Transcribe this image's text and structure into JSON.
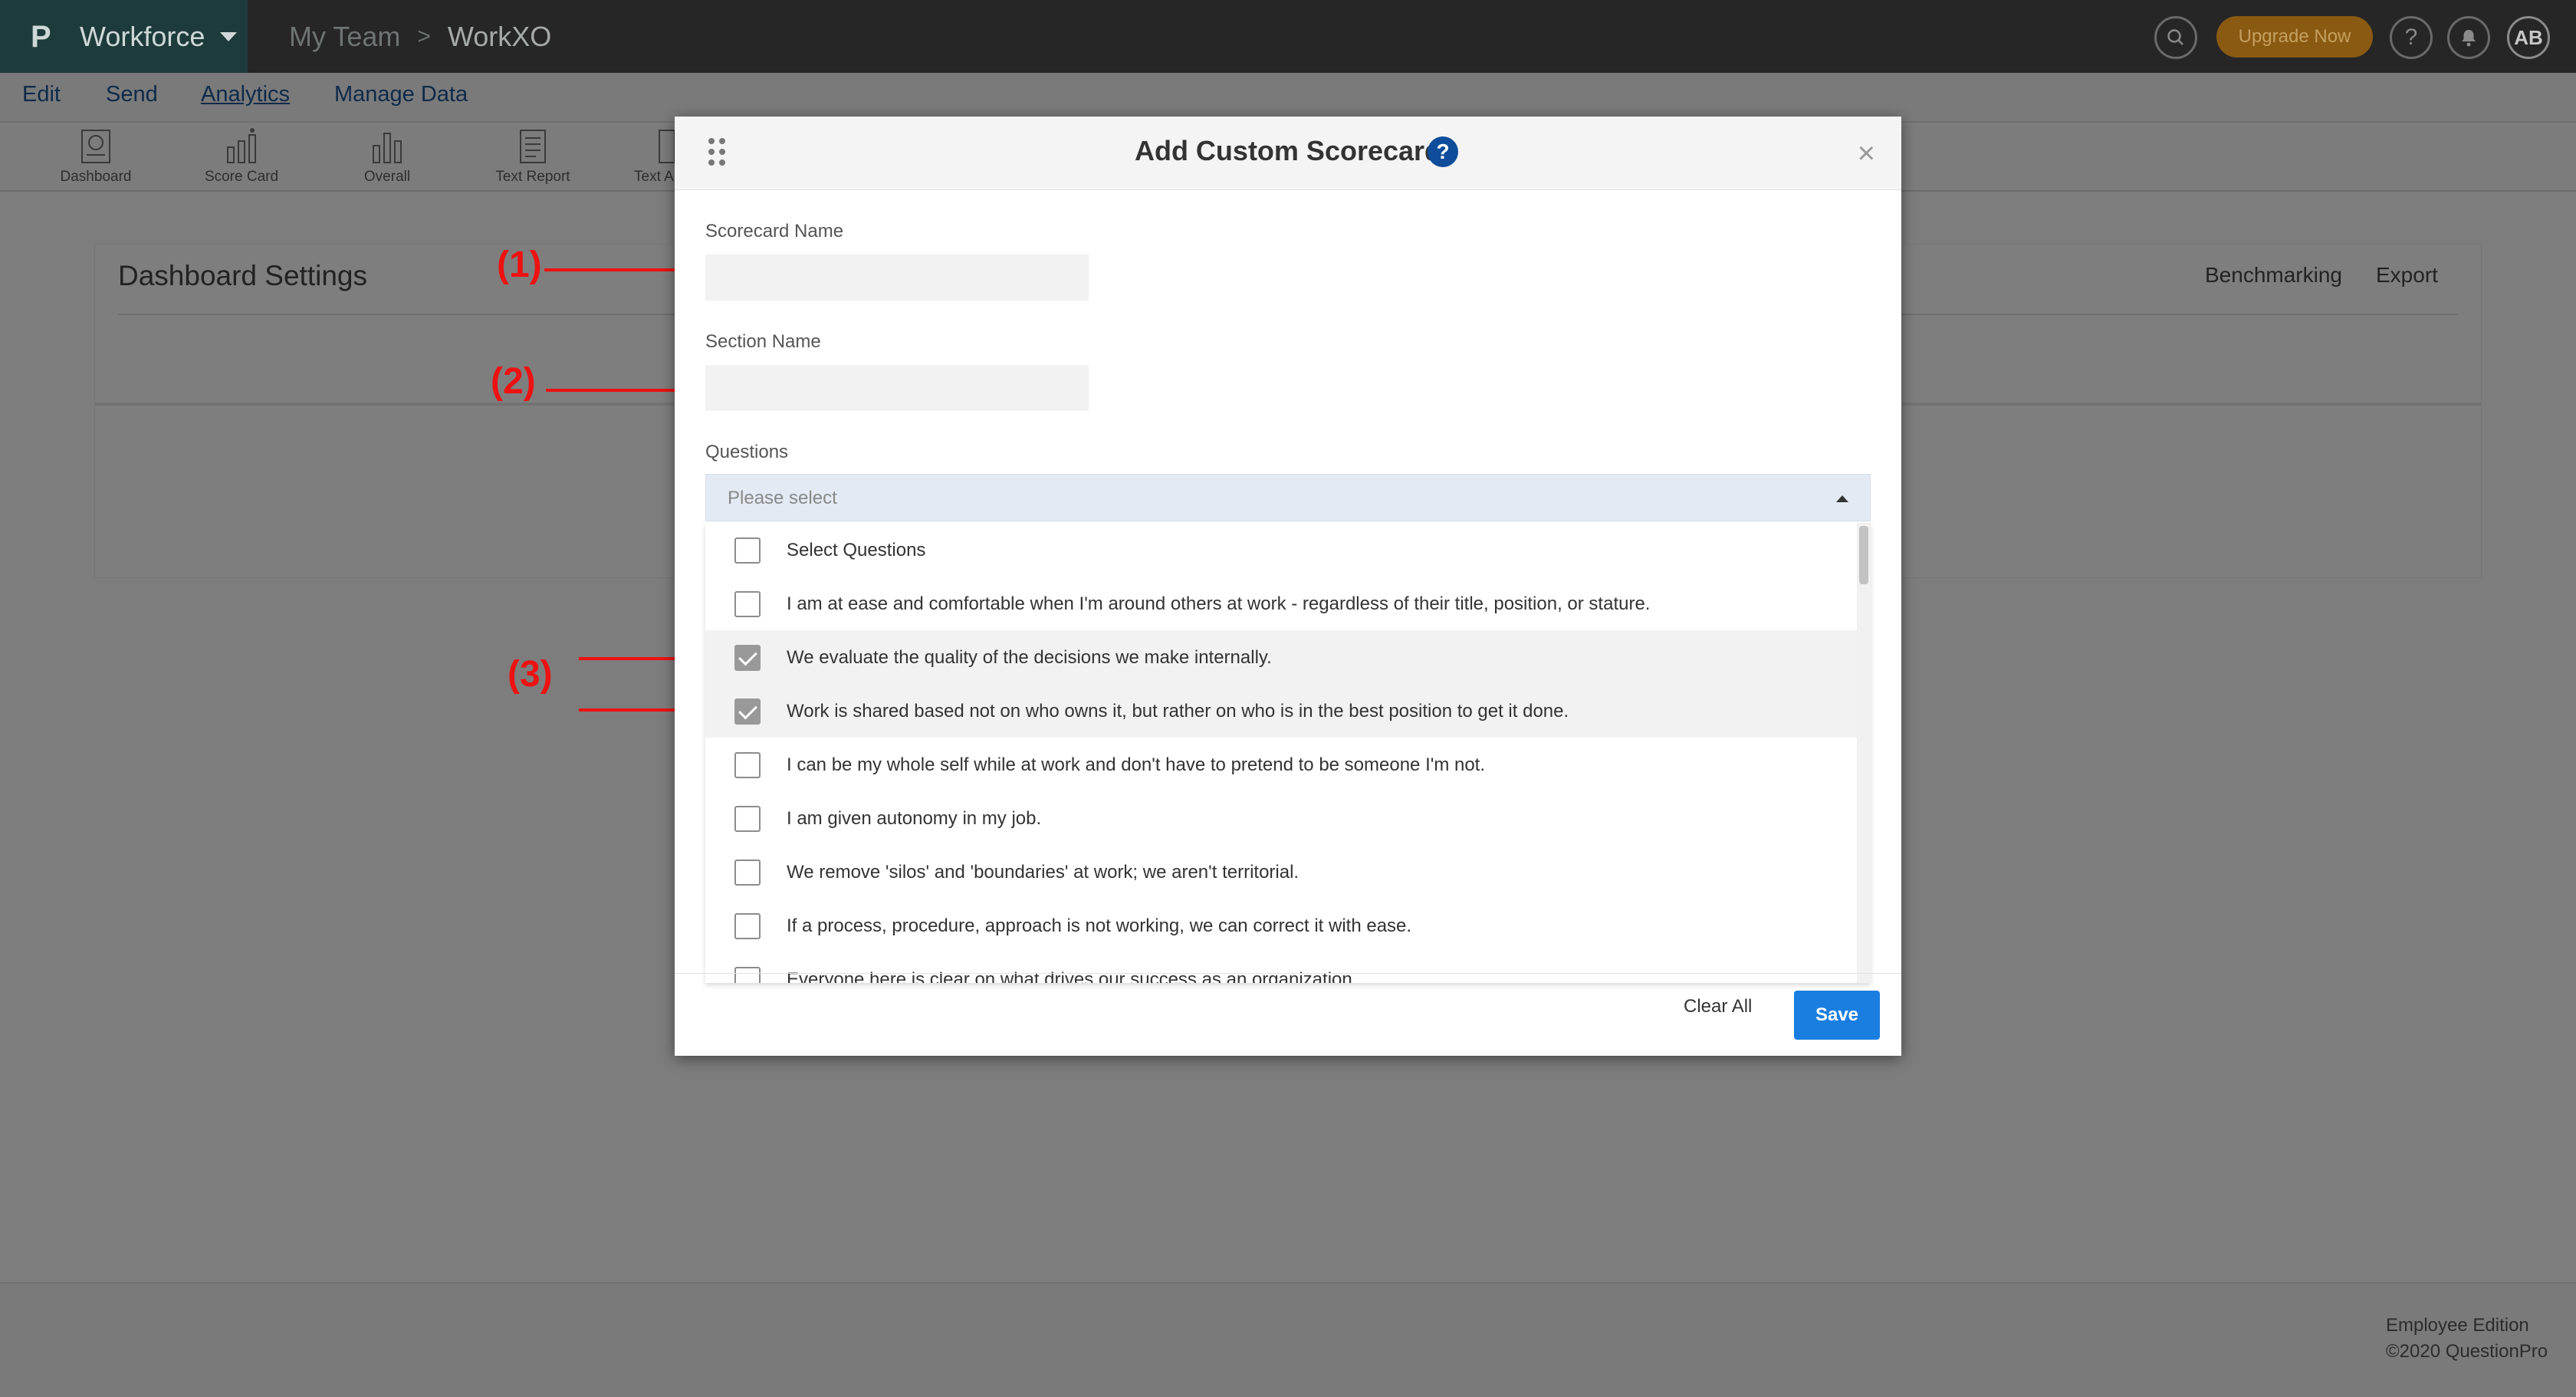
{
  "topbar": {
    "brand_logo": "P",
    "brand_name": "Workforce",
    "breadcrumb": [
      "My Team",
      "WorkXO"
    ],
    "breadcrumb_sep": ">",
    "upgrade_label": "Upgrade Now",
    "help_glyph": "?",
    "avatar_initials": "AB",
    "icons": [
      "search-icon",
      "help-icon",
      "bell-icon"
    ]
  },
  "menu": {
    "items": [
      "Edit",
      "Send",
      "Analytics",
      "Manage Data"
    ],
    "active": "Analytics"
  },
  "toolbar": {
    "items": [
      "Dashboard",
      "Score Card",
      "Overall",
      "Text Report",
      "Text A"
    ]
  },
  "panel": {
    "title": "Dashboard Settings",
    "benchmarking": "Benchmarking",
    "export": "Export"
  },
  "annotations": [
    "(1)",
    "(2)",
    "(3)"
  ],
  "annotation_color": "#ee1111",
  "modal": {
    "title": "Add Custom Scorecard",
    "help_glyph": "?",
    "close_glyph": "×",
    "scorecard_name_label": "Scorecard Name",
    "scorecard_name_value": "",
    "section_name_label": "Section Name",
    "section_name_value": "",
    "questions_label": "Questions",
    "questions_placeholder": "Please select",
    "options": [
      {
        "label": "Select Questions",
        "checked": false
      },
      {
        "label": "I am at ease and comfortable when I'm around others at work - regardless of their title, position, or stature.",
        "checked": false
      },
      {
        "label": "We evaluate the quality of the decisions we make internally.",
        "checked": true
      },
      {
        "label": "Work is shared based not on who owns it, but rather on who is in the best position to get it done.",
        "checked": true
      },
      {
        "label": "I can be my whole self while at work and don't have to pretend to be someone I'm not.",
        "checked": false
      },
      {
        "label": "I am given autonomy in my job.",
        "checked": false
      },
      {
        "label": "We remove 'silos' and 'boundaries' at work; we aren't territorial.",
        "checked": false
      },
      {
        "label": "If a process, procedure, approach is not working, we can correct it with ease.",
        "checked": false
      },
      {
        "label": "Everyone here is clear on what drives our success as an organization.",
        "checked": false
      }
    ],
    "clear_all_label": "Clear All",
    "save_label": "Save",
    "save_color": "#1a7ee0"
  },
  "footer": {
    "edition": "Employee Edition",
    "copyright": "©2020 QuestionPro"
  }
}
